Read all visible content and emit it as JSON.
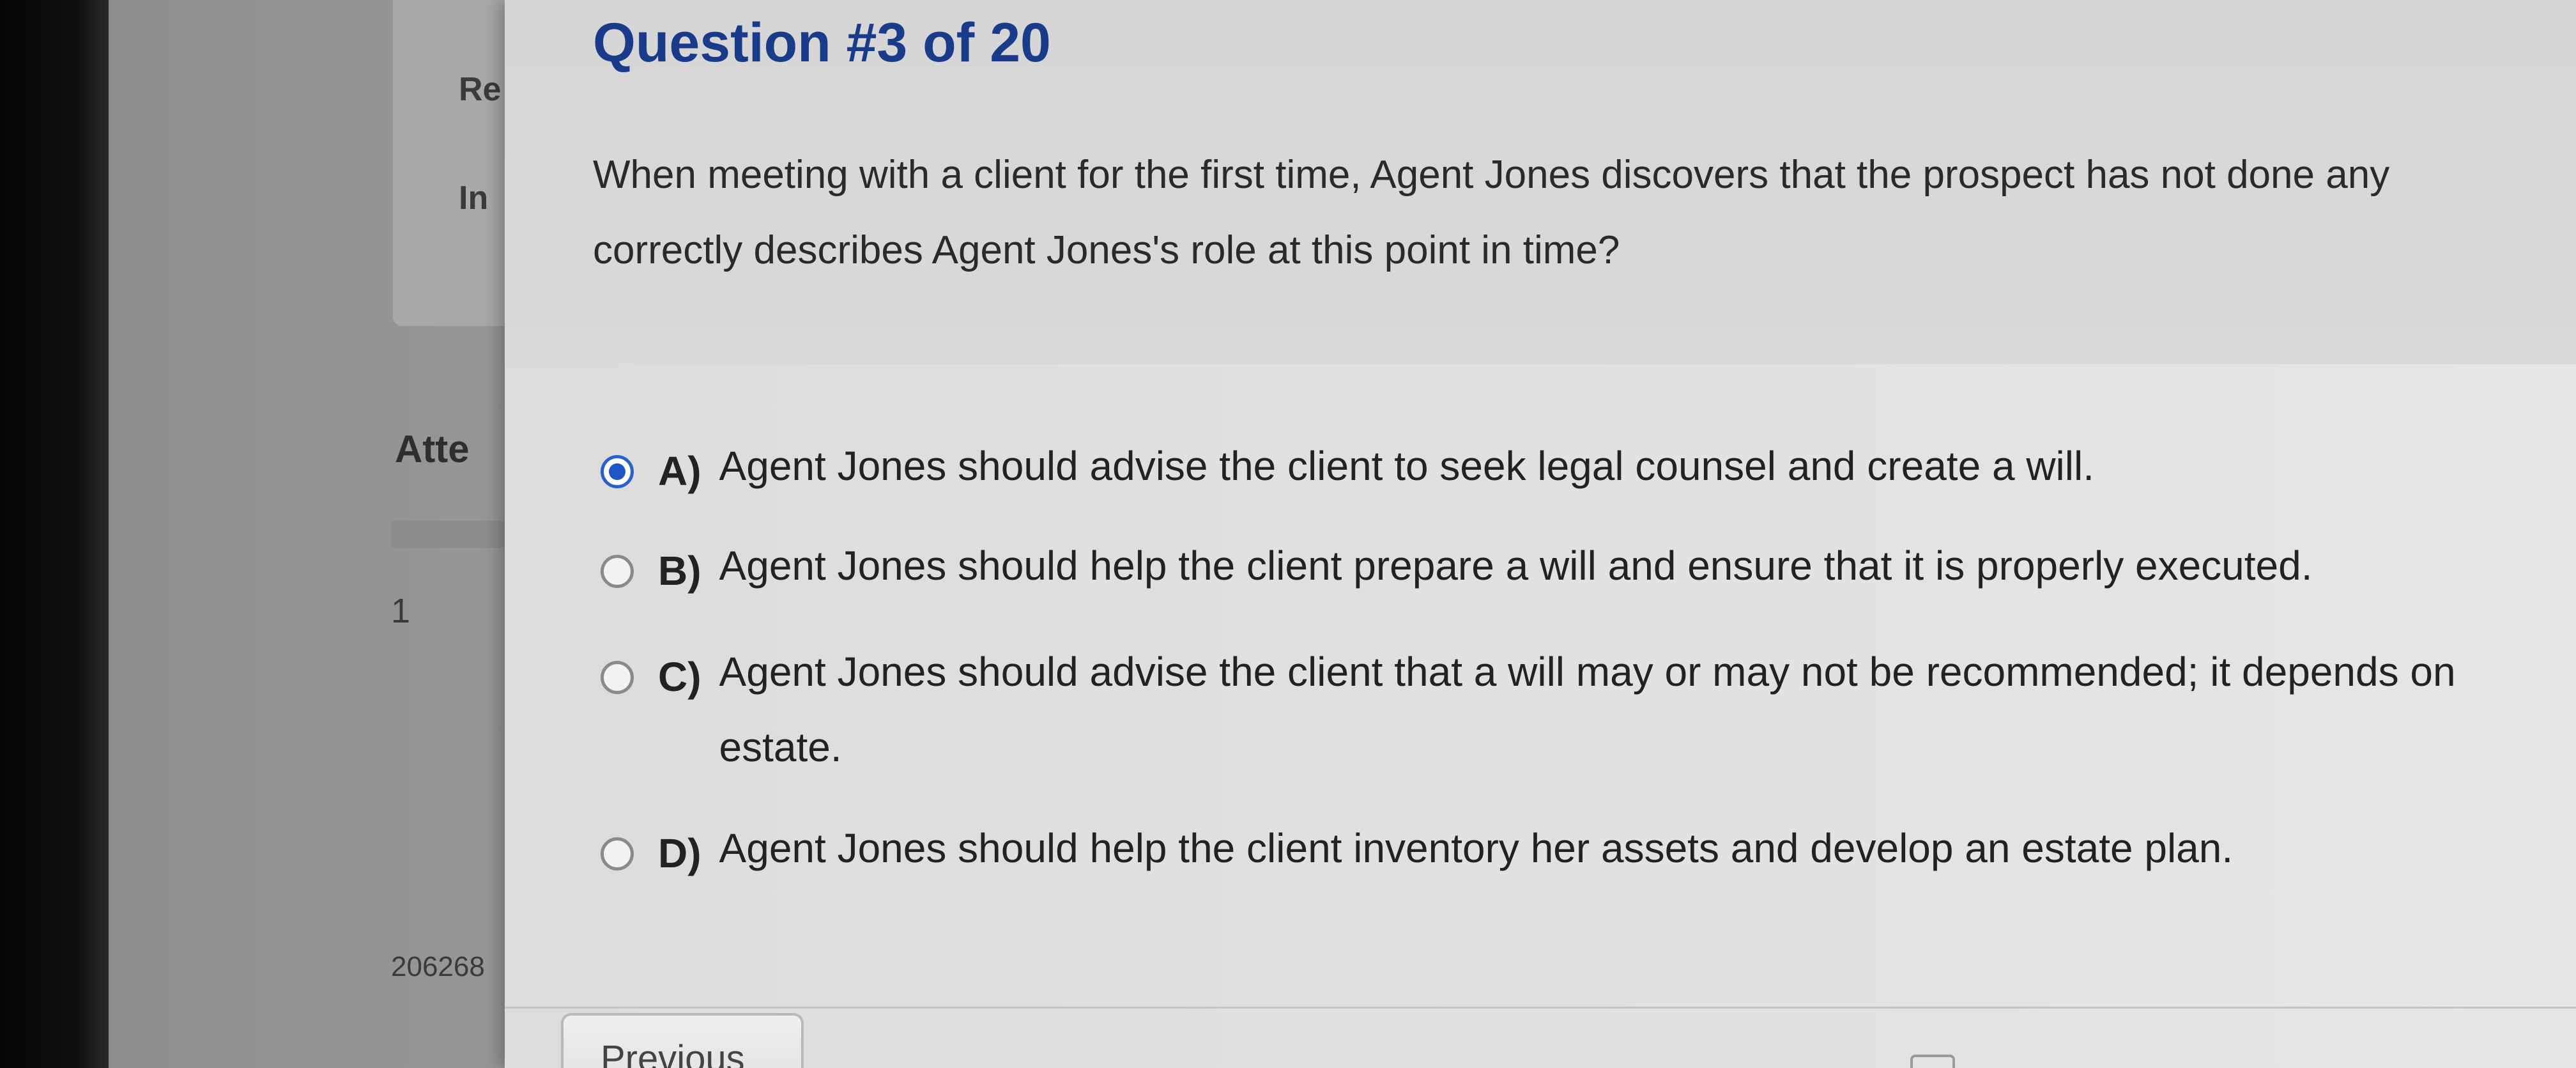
{
  "background": {
    "labels": [
      "Re",
      "In",
      "Atte",
      "1",
      "206268"
    ]
  },
  "question": {
    "title": "Question #3 of 20",
    "stem_lines": [
      "When meeting with a client for the first time, Agent Jones discovers that the prospect has not done any",
      "correctly describes Agent Jones's role at this point in time?"
    ]
  },
  "choices": [
    {
      "letter": "A)",
      "lines": [
        "Agent Jones should advise the client to seek legal counsel and create a will."
      ],
      "selected": true
    },
    {
      "letter": "B)",
      "lines": [
        "Agent Jones should help the client prepare a will and ensure that it is properly executed."
      ],
      "selected": false
    },
    {
      "letter": "C)",
      "lines": [
        "Agent Jones should advise the client that a will may or may not be recommended; it depends on",
        "estate."
      ],
      "selected": false
    },
    {
      "letter": "D)",
      "lines": [
        "Agent Jones should help the client inventory her assets and develop an estate plan."
      ],
      "selected": false
    }
  ],
  "navigation": {
    "previous_label": "Previous"
  },
  "colors": {
    "title": "#1a3a8a",
    "radio_selected": "#1e56c8"
  }
}
